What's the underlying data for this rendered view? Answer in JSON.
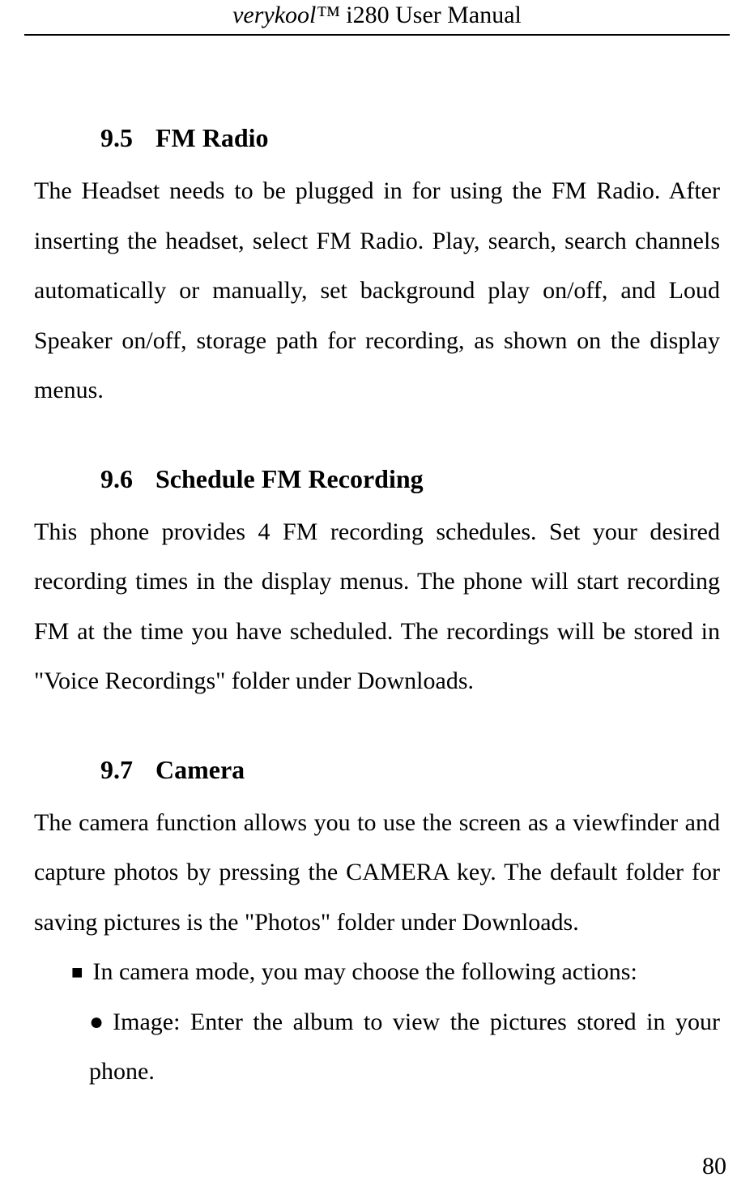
{
  "header": {
    "brand": "verykool™",
    "product": " i280 User Manual"
  },
  "sections": {
    "s1": {
      "number": "9.5",
      "title": "FM Radio",
      "body": "The Headset needs to be plugged in for using the FM Radio. After inserting the headset, select FM Radio. Play, search, search channels automatically or manually, set background play on/off, and Loud Speaker on/off, storage path for recording, as shown on the display menus."
    },
    "s2": {
      "number": "9.6",
      "title": "Schedule FM Recording",
      "body": "This phone provides 4 FM recording schedules. Set your desired recording times in the display menus. The phone will start recording FM at the time you have scheduled. The recordings will be stored in \"Voice Recordings\" folder under Downloads."
    },
    "s3": {
      "number": "9.7",
      "title": "Camera",
      "body": "The camera function allows you to use the screen as a viewfinder and capture photos by pressing the CAMERA key. The default folder for saving pictures is the \"Photos\" folder under Downloads.",
      "bullet_square": "In camera mode, you may choose the following actions:",
      "bullet_circle": "Image: Enter the album to view the pictures stored in your phone."
    }
  },
  "page_number": "80"
}
